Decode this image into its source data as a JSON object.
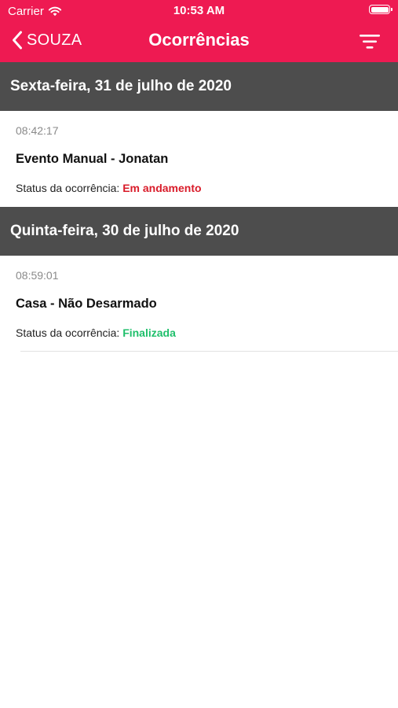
{
  "status_bar": {
    "carrier": "Carrier",
    "time": "10:53 AM"
  },
  "nav": {
    "back_label": "SOUZA",
    "title": "Ocorrências"
  },
  "icons": {
    "back": "chevron-left-icon",
    "filter": "filter-icon",
    "wifi": "wifi-icon",
    "battery": "battery-icon"
  },
  "colors": {
    "accent": "#ee1a52",
    "section_bg": "#4d4d4d",
    "status_in_progress": "#d91c2a",
    "status_finished": "#1fbf6b"
  },
  "sections": [
    {
      "header": "Sexta-feira, 31 de julho de 2020",
      "items": [
        {
          "time": "08:42:17",
          "title": "Evento Manual - Jonatan",
          "status_label": "Status da ocorrência: ",
          "status_value": "Em andamento"
        }
      ]
    },
    {
      "header": "Quinta-feira, 30 de julho de 2020",
      "items": [
        {
          "time": "08:59:01",
          "title": "Casa - Não Desarmado",
          "status_label": "Status da ocorrência: ",
          "status_value": "Finalizada"
        }
      ]
    }
  ]
}
